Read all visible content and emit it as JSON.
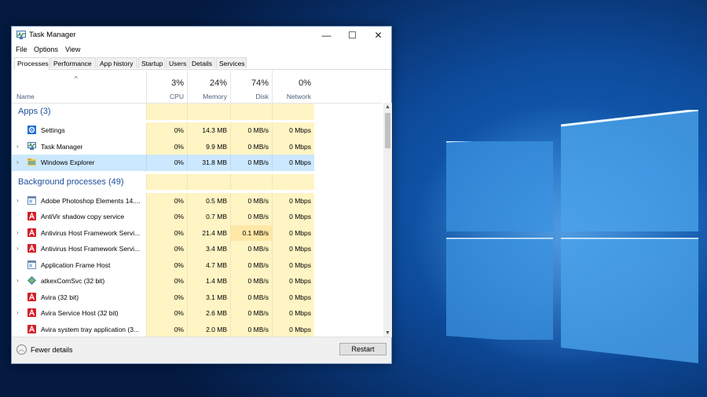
{
  "window": {
    "title": "Task Manager"
  },
  "menu": [
    "File",
    "Options",
    "View"
  ],
  "tabs": [
    "Processes",
    "Performance",
    "App history",
    "Startup",
    "Users",
    "Details",
    "Services"
  ],
  "columns": {
    "name": "Name",
    "cpu": {
      "pct": "3%",
      "label": "CPU"
    },
    "memory": {
      "pct": "24%",
      "label": "Memory"
    },
    "disk": {
      "pct": "74%",
      "label": "Disk"
    },
    "network": {
      "pct": "0%",
      "label": "Network"
    }
  },
  "sections": {
    "apps": "Apps (3)",
    "background": "Background processes (49)"
  },
  "apps": [
    {
      "name": "Settings",
      "cpu": "0%",
      "memory": "14.3 MB",
      "disk": "0 MB/s",
      "network": "0 Mbps",
      "icon": "gear-icon"
    },
    {
      "name": "Task Manager",
      "cpu": "0%",
      "memory": "9.9 MB",
      "disk": "0 MB/s",
      "network": "0 Mbps",
      "icon": "task-manager-icon"
    },
    {
      "name": "Windows Explorer",
      "cpu": "0%",
      "memory": "31.8 MB",
      "disk": "0 MB/s",
      "network": "0 Mbps",
      "icon": "folder-icon"
    }
  ],
  "background": [
    {
      "name": "Adobe Photoshop Elements 14....",
      "cpu": "0%",
      "memory": "0.5 MB",
      "disk": "0 MB/s",
      "network": "0 Mbps",
      "icon": "app-window-icon"
    },
    {
      "name": "AntiVir shadow copy service",
      "cpu": "0%",
      "memory": "0.7 MB",
      "disk": "0 MB/s",
      "network": "0 Mbps",
      "icon": "avira-icon"
    },
    {
      "name": "Antivirus Host Framework Servi...",
      "cpu": "0%",
      "memory": "21.4 MB",
      "disk": "0.1 MB/s",
      "network": "0 Mbps",
      "icon": "avira-icon"
    },
    {
      "name": "Antivirus Host Framework Servi...",
      "cpu": "0%",
      "memory": "3.4 MB",
      "disk": "0 MB/s",
      "network": "0 Mbps",
      "icon": "avira-icon"
    },
    {
      "name": "Application Frame Host",
      "cpu": "0%",
      "memory": "4.7 MB",
      "disk": "0 MB/s",
      "network": "0 Mbps",
      "icon": "app-window-icon"
    },
    {
      "name": "atkexComSvc (32 bit)",
      "cpu": "0%",
      "memory": "1.4 MB",
      "disk": "0 MB/s",
      "network": "0 Mbps",
      "icon": "asus-diamond-icon"
    },
    {
      "name": "Avira (32 bit)",
      "cpu": "0%",
      "memory": "3.1 MB",
      "disk": "0 MB/s",
      "network": "0 Mbps",
      "icon": "avira-icon"
    },
    {
      "name": "Avira Service Host (32 bit)",
      "cpu": "0%",
      "memory": "2.6 MB",
      "disk": "0 MB/s",
      "network": "0 Mbps",
      "icon": "avira-icon"
    },
    {
      "name": "Avira system tray application (3...",
      "cpu": "0%",
      "memory": "2.0 MB",
      "disk": "0 MB/s",
      "network": "0 Mbps",
      "icon": "avira-icon"
    }
  ],
  "footer": {
    "fewer_details": "Fewer details",
    "restart": "Restart"
  },
  "colors": {
    "accent": "#1f4e9c",
    "heat": "#fff4c4",
    "selected": "#cce8ff",
    "desktop": "#0d4a9a"
  }
}
